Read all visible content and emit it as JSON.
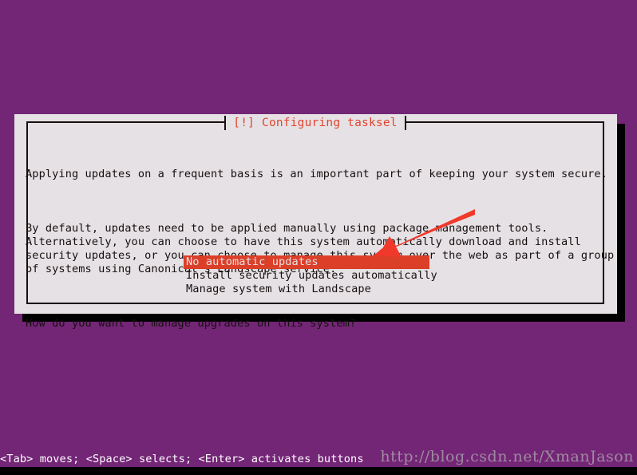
{
  "colors": {
    "background_purple": "#732576",
    "dialog_background": "#e6e1e4",
    "dialog_border": "#16100f",
    "title_red": "#e04430",
    "highlight_red": "#db3f28",
    "highlight_text": "#e6e1e4",
    "annotation_red": "#f0392b",
    "status_text": "#ffffff",
    "watermark_grey": "#9f8ba0",
    "shadow_black": "#000000"
  },
  "dialog": {
    "title": "[!] Configuring tasksel",
    "paragraphs": [
      "Applying updates on a frequent basis is an important part of keeping your system secure.",
      "By default, updates need to be applied manually using package management tools.\nAlternatively, you can choose to have this system automatically download and install\nsecurity updates, or you can choose to manage this system over the web as part of a group\nof systems using Canonical's Landscape service.",
      "How do you want to manage upgrades on this system?"
    ],
    "options": [
      {
        "label": "No automatic updates",
        "selected": true
      },
      {
        "label": "Install security updates automatically",
        "selected": false
      },
      {
        "label": "Manage system with Landscape",
        "selected": false
      }
    ]
  },
  "annotation": {
    "type": "arrow",
    "points_to": "No automatic updates"
  },
  "status_bar": {
    "text": "<Tab> moves; <Space> selects; <Enter> activates buttons"
  },
  "watermark": {
    "text": "http://blog.csdn.net/XmanJason"
  }
}
